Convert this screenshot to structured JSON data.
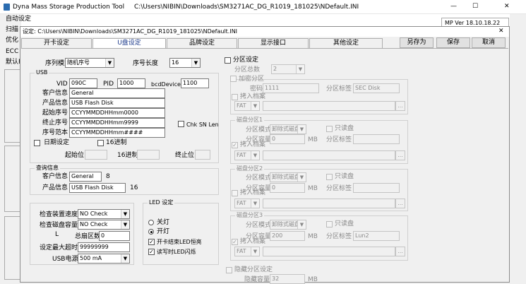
{
  "main_window": {
    "title": "Dyna Mass Storage Production Tool",
    "path": "C:\\Users\\NIBIN\\Downloads\\SM3271AC_DG_R1019_181025\\NDefault.INI",
    "menu_items": [
      "自动设定",
      "扫描",
      "优化",
      "ECC",
      "默认F"
    ],
    "version": "MP Ver 18.10.18.22",
    "window_controls": {
      "min": "—",
      "max": "☐",
      "close": "✕"
    }
  },
  "dialog": {
    "title": "设定: C:\\Users\\NIBIN\\Downloads\\SM3271AC_DG_R1019_181025\\NDefault.INI",
    "close": "✕",
    "tabs": [
      "开卡设定",
      "U盘设定",
      "品牌设定",
      "显示接口",
      "其他设定"
    ],
    "buttons": {
      "save_as": "另存为",
      "save": "保存",
      "cancel": "取消"
    }
  },
  "serial": {
    "mode_label": "序列模式",
    "mode_value": "随机序号",
    "length_label": "序号长度",
    "length_value": "16"
  },
  "usb": {
    "group": "USB",
    "vid_label": "VID",
    "vid": "090C",
    "pid_label": "PID",
    "pid": "1000",
    "bcd_label": "bcdDevice",
    "bcd": "1100",
    "vendor_label": "客户信息",
    "vendor": "General",
    "product_label": "产品信息",
    "product": "USB Flash Disk",
    "start_label": "起始序号",
    "start": "CCYYMMDDHHmm0000",
    "end_label": "终止序号",
    "end": "CCYYMMDDHHmm9999",
    "sample_label": "序号范本",
    "sample": "CCYYMMDDHHmm####",
    "chk_sn_label": "Chk SN Len",
    "date_label": "日期设定",
    "hex_label": "16进制",
    "start_pos_label": "起始位",
    "hex2_label": "16进制",
    "end_pos_label": "终止位"
  },
  "query": {
    "group": "查询信息",
    "vendor_label": "客户信息",
    "vendor": "General",
    "vendor_len": "8",
    "product_label": "产品信息",
    "product": "USB Flash Disk",
    "product_len": "16"
  },
  "check": {
    "device_label": "检查装置速度",
    "device_value": "NO Check",
    "capacity_label": "检查磁盘容量",
    "capacity_value": "NO Check",
    "l_label": "L",
    "total_label": "总扇区数",
    "total_value": "0",
    "timeout_label": "设定最大超时",
    "timeout_value": "99999999",
    "power_label": "USB电源",
    "power_value": "500 mA"
  },
  "led": {
    "group": "LED 设定",
    "off": "关灯",
    "on": "开灯",
    "end_flash": "开卡结束LED恒亮",
    "rw_flash": "读写时LED闪烁"
  },
  "partition": {
    "group": "分区设定",
    "count_label": "分区总数",
    "count_value": "2",
    "encrypt_group": "加密分区",
    "password_label": "密码",
    "password_value": "1111",
    "label_label": "分区标签",
    "label_value": "SEC Disk",
    "copy_label": "拷入档案",
    "fs": "FAT",
    "disk1_group": "磁盘分区1",
    "disk2_group": "磁盘分区2",
    "disk3_group": "磁盘分区3",
    "mode_label": "分区模式",
    "mode_value": "卸除式磁盘",
    "readonly_label": "只读盘",
    "cap_label": "分区容量",
    "cap1": "0",
    "cap2": "0",
    "cap3": "200",
    "mb": "MB",
    "label3": "Lun2",
    "browse": "...",
    "hidden_group": "隐藏分区设定",
    "hidden_cap_label": "隐藏容量",
    "hidden_cap": "32"
  }
}
